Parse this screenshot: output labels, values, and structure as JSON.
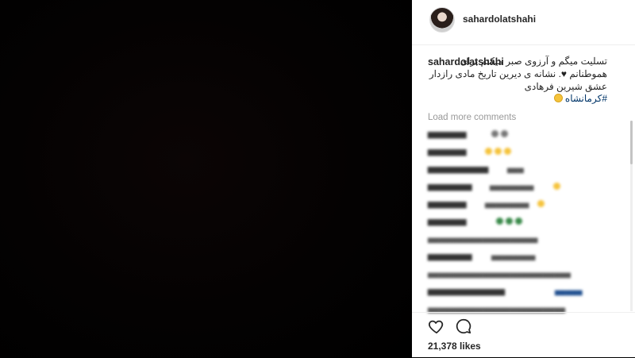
{
  "post": {
    "username": "sahardolatshahi",
    "caption_username": "sahardolatshahi",
    "caption_text": "تسلیت میگم و آرزوی صبر میکنم برای هموطنانم",
    "caption_text2": ". نشانه ی دیرین تاریخ مادی رازدار عشق شیرین فرهادی",
    "hashtag": "#کرمانشاه",
    "load_more_label": "Load more comments",
    "likes": "21,378 likes"
  },
  "icons": {
    "like": "heart-outline-icon",
    "comment": "speech-bubble-icon",
    "caption_emoji_heart": "black-heart-emoji",
    "caption_emoji_face": "smiling-face-emoji"
  },
  "colors": {
    "panel_bg": "#ffffff",
    "media_bg": "#000000",
    "text": "#262626",
    "muted": "#999999",
    "hashtag": "#003569"
  }
}
